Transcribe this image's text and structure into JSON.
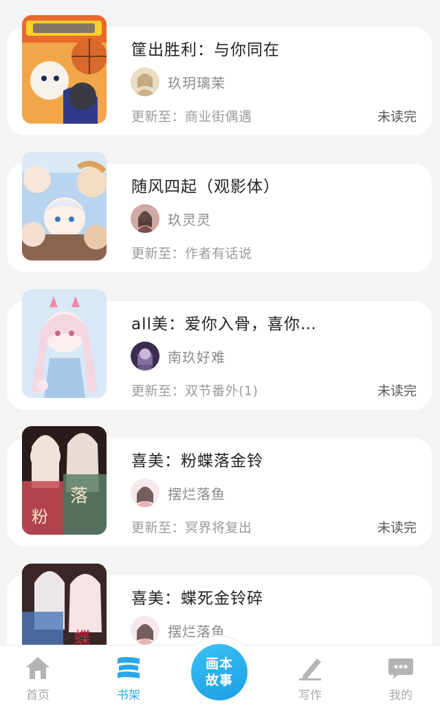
{
  "books": [
    {
      "title": "筐出胜利：与你同在",
      "author": "玖玥璃茉",
      "update_prefix": "更新至：",
      "chapter": "商业街偶遇",
      "status": "未读完",
      "cover": {
        "bg": "#f2a64a",
        "accent": "#2f3b8a"
      },
      "avatar_color": "#c9b089"
    },
    {
      "title": "随风四起（观影体）",
      "author": "玖灵灵",
      "update_prefix": "更新至：",
      "chapter": "作者有话说",
      "status": "",
      "cover": {
        "bg": "#f3d9c6",
        "accent": "#8fb6e0"
      },
      "avatar_color": "#7a4e4a"
    },
    {
      "title": "all美：爱你入骨，喜你…",
      "author": "南玖好难",
      "update_prefix": "更新至：",
      "chapter": "双节番外(1)",
      "status": "未读完",
      "cover": {
        "bg": "#d8e8f6",
        "accent": "#f4d6df"
      },
      "avatar_color": "#6b5a86"
    },
    {
      "title": "喜美：粉蝶落金铃",
      "author": "摆烂落鱼",
      "update_prefix": "更新至：",
      "chapter": "冥界将复出",
      "status": "未读完",
      "cover": {
        "bg": "#2b1b1b",
        "accent": "#f0e2d6"
      },
      "avatar_color": "#e7b4b4"
    },
    {
      "title": "喜美：蝶死金铃碎",
      "author": "摆烂落鱼",
      "update_prefix": "",
      "chapter": "",
      "status": "",
      "cover": {
        "bg": "#3a2626",
        "accent": "#f6e3e6"
      },
      "avatar_color": "#e7b4b4"
    }
  ],
  "tabbar": {
    "home": "首页",
    "shelf": "书架",
    "center_line1": "画本",
    "center_line2": "故事",
    "write": "写作",
    "me": "我的",
    "active_color": "#2aa7e8",
    "inactive_color": "#a8a8a8"
  }
}
